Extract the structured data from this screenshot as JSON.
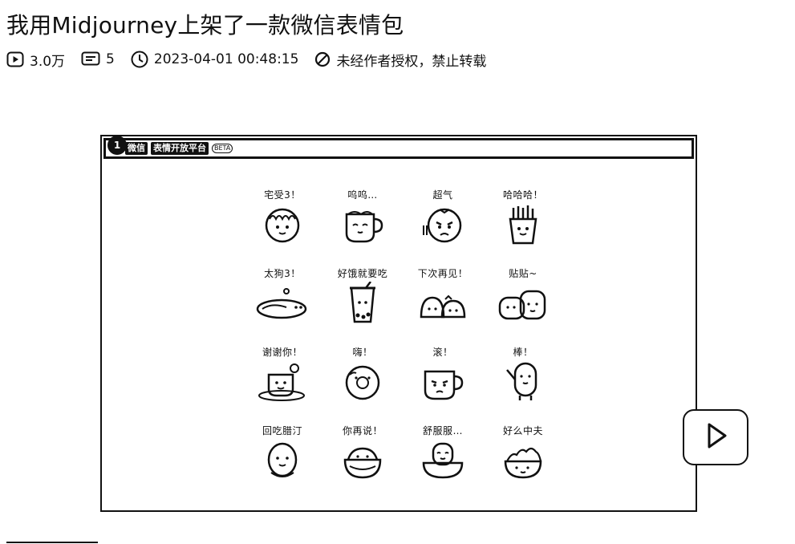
{
  "article": {
    "title": "我用Midjourney上架了一款微信表情包"
  },
  "meta": {
    "views": "3.0万",
    "comments": "5",
    "datetime": "2023-04-01 00:48:15",
    "copyright": "未经作者授权，禁止转载"
  },
  "screenshot": {
    "bar_badge": "1",
    "bar_tab1": "微信",
    "bar_tab2": "表情开放平台",
    "bar_chip": "BETA",
    "stickers": [
      {
        "caption": "宅受3！"
      },
      {
        "caption": "呜呜…"
      },
      {
        "caption": "超气"
      },
      {
        "caption": "哈哈哈！"
      },
      {
        "caption": "太狗3！"
      },
      {
        "caption": "好饿就要吃"
      },
      {
        "caption": "下次再见！"
      },
      {
        "caption": "贴贴~"
      },
      {
        "caption": "谢谢你！"
      },
      {
        "caption": "嗨！"
      },
      {
        "caption": "滚！"
      },
      {
        "caption": "棒！"
      },
      {
        "caption": "回吃腊汀"
      },
      {
        "caption": "你再说！"
      },
      {
        "caption": "舒服服…"
      },
      {
        "caption": "好么中夫"
      }
    ]
  },
  "icons": {
    "views": "play-icon",
    "comments": "comment-icon",
    "time": "clock-icon",
    "copyright": "no-reprint-icon",
    "video": "play-button-icon"
  }
}
